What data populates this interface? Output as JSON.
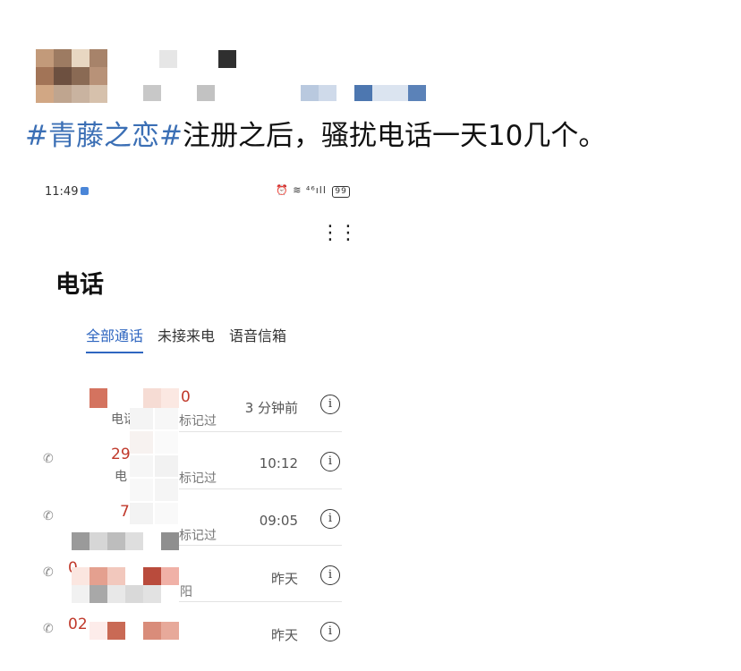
{
  "post": {
    "hashtag": "#青藤之恋#",
    "text": "注册之后，骚扰电话一天10几个。"
  },
  "phone": {
    "status_time": "11:49",
    "status_icons": "⏰ ≋ ⁴⁶ıll",
    "battery": "99",
    "more_icon": "⋮⋮",
    "title": "电话",
    "tabs": [
      "全部通话",
      "未接来电",
      "语音信箱"
    ],
    "calls": [
      {
        "number": "80",
        "number_tail": "0",
        "sub": "电话",
        "label": "标记过",
        "time": "3 分钟前"
      },
      {
        "number": "29",
        "number_tail": "",
        "sub": "电",
        "label": "标记过",
        "time": "10:12"
      },
      {
        "number": "7",
        "number_tail": "",
        "sub": "",
        "label": "标记过",
        "time": "09:05"
      },
      {
        "number": "0",
        "number_tail": "",
        "sub": "",
        "label": "阳",
        "time": "昨天"
      },
      {
        "number": "02",
        "number_tail": "",
        "sub": "",
        "label": "",
        "time": "昨天"
      }
    ]
  }
}
